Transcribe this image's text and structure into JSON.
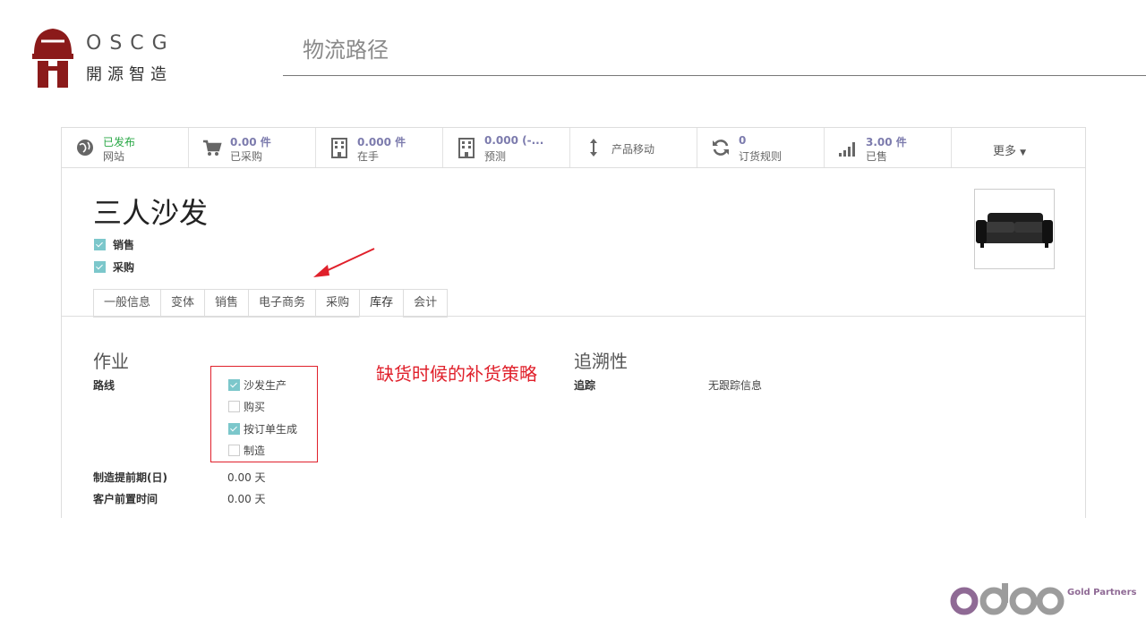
{
  "slide": {
    "logo_en": "OSCG",
    "logo_cn": "開源智造",
    "title": "物流路径",
    "partner_badge": "Gold Partners",
    "colors": {
      "brand_red": "#8b1a1a",
      "odoo_purple": "#8f6a95",
      "odoo_grey": "#9c9c9c",
      "annotation_red": "#e0202b"
    }
  },
  "smart_buttons": [
    {
      "icon": "globe-icon",
      "value": "已发布",
      "label": "网站"
    },
    {
      "icon": "cart-icon",
      "value": "0.00 件",
      "label": "已采购"
    },
    {
      "icon": "building-icon",
      "value": "0.000 件",
      "label": "在手"
    },
    {
      "icon": "building-icon",
      "value": "0.000 (-...",
      "label": "预测"
    },
    {
      "icon": "updown-arrow-icon",
      "label": "产品移动"
    },
    {
      "icon": "refresh-icon",
      "value": "0",
      "label": "订货规则"
    },
    {
      "icon": "signal-bars-icon",
      "value": "3.00 件",
      "label": "已售"
    },
    {
      "label": "更多"
    }
  ],
  "product": {
    "name": "三人沙发",
    "sale_ok": "销售",
    "purchase_ok": "采购",
    "image": "black-sofa-image"
  },
  "tabs": [
    "一般信息",
    "变体",
    "销售",
    "电子商务",
    "采购",
    "库存",
    "会计"
  ],
  "active_tab": "库存",
  "operations": {
    "title": "作业",
    "routes_label": "路线",
    "routes": [
      {
        "label": "沙发生产",
        "checked": true
      },
      {
        "label": "购买",
        "checked": false
      },
      {
        "label": "按订单生成",
        "checked": true
      },
      {
        "label": "制造",
        "checked": false
      }
    ],
    "mfg_lead_label": "制造提前期(日)",
    "mfg_lead_value": "0.00 天",
    "customer_lead_label": "客户前置时间",
    "customer_lead_value": "0.00 天"
  },
  "traceability": {
    "title": "追溯性",
    "tracking_label": "追踪",
    "tracking_value": "无跟踪信息"
  },
  "annotation": "缺货时候的补货策略"
}
